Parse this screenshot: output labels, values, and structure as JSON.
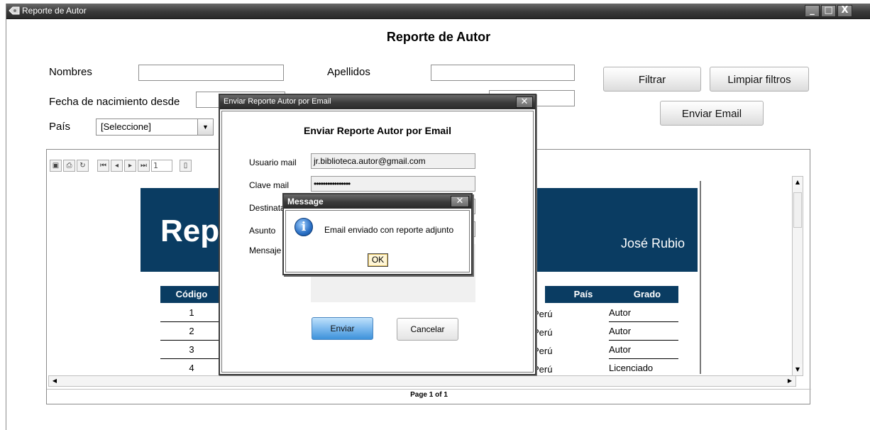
{
  "main_window": {
    "title": "Reporte de Autor",
    "heading": "Reporte de Autor",
    "controls": {
      "minimize": "_",
      "maximize": "□",
      "close": "X"
    }
  },
  "filters": {
    "nombres_label": "Nombres",
    "nombres_value": "",
    "apellidos_label": "Apellidos",
    "apellidos_value": "",
    "fecha_desde_label": "Fecha de  nacimiento desde",
    "fecha_desde_value": "",
    "fecha_hasta_value": "",
    "pais_label": "País",
    "pais_selected": "[Seleccione]"
  },
  "buttons": {
    "filtrar": "Filtrar",
    "limpiar": "Limpiar filtros",
    "enviar_email": "Enviar Email"
  },
  "viewer": {
    "page_input": "1",
    "page_status": "Page 1 of 1",
    "toolbar_icons": [
      "save-icon",
      "print-icon",
      "refresh-icon",
      "first-page-icon",
      "prev-page-icon",
      "next-page-icon",
      "last-page-icon",
      "document-icon"
    ]
  },
  "report": {
    "banner_title": "Rep",
    "author": "José Rubio",
    "columns": {
      "codigo": "Código",
      "pais": "País",
      "grado": "Grado"
    },
    "rows": [
      {
        "codigo": "1",
        "pais": "Perú",
        "grado": "Autor"
      },
      {
        "codigo": "2",
        "pais": "Perú",
        "grado": "Autor"
      },
      {
        "codigo": "3",
        "pais": "Perú",
        "grado": "Autor"
      },
      {
        "codigo": "4",
        "pais": "Perú",
        "grado": "Licenciado"
      }
    ],
    "banner_color": "#0a3c62"
  },
  "email_dialog": {
    "title": "Enviar Reporte Autor  por Email",
    "heading": "Enviar Reporte Autor por Email",
    "usuario_label": "Usuario mail",
    "usuario_value": "jr.biblioteca.autor@gmail.com",
    "clave_label": "Clave mail",
    "clave_value": "••••••••••••••••",
    "destinatario_label": "Destinata",
    "asunto_label": "Asunto",
    "mensaje_label": "Mensaje",
    "send_button": "Enviar",
    "cancel_button": "Cancelar"
  },
  "message_box": {
    "title": "Message",
    "text": "Email enviado con reporte adjunto",
    "ok_button": "OK"
  }
}
